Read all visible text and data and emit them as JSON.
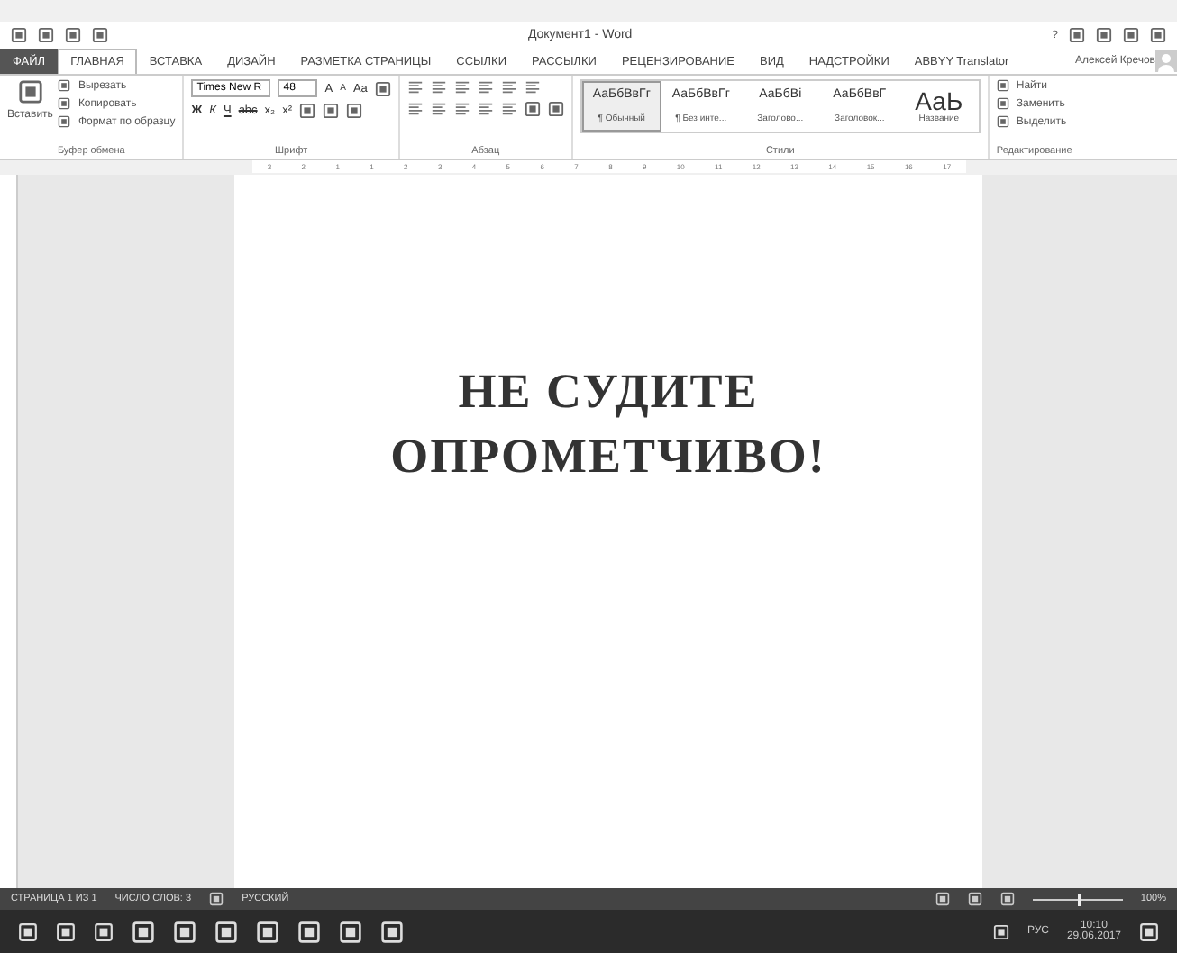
{
  "window": {
    "title": "Документ1 - Word",
    "help": "?",
    "user": "Алексей Кречов"
  },
  "tabs": [
    {
      "label": "ФАЙЛ",
      "kind": "file",
      "selected": false
    },
    {
      "label": "ГЛАВНАЯ",
      "kind": "tab",
      "selected": true
    },
    {
      "label": "ВСТАВКА",
      "kind": "tab",
      "selected": false
    },
    {
      "label": "ДИЗАЙН",
      "kind": "tab",
      "selected": false
    },
    {
      "label": "РАЗМЕТКА СТРАНИЦЫ",
      "kind": "tab",
      "selected": false
    },
    {
      "label": "ССЫЛКИ",
      "kind": "tab",
      "selected": false
    },
    {
      "label": "РАССЫЛКИ",
      "kind": "tab",
      "selected": false
    },
    {
      "label": "РЕЦЕНЗИРОВАНИЕ",
      "kind": "tab",
      "selected": false
    },
    {
      "label": "ВИД",
      "kind": "tab",
      "selected": false
    },
    {
      "label": "НАДСТРОЙКИ",
      "kind": "tab",
      "selected": false
    },
    {
      "label": "ABBYY Translator",
      "kind": "tab",
      "selected": false
    }
  ],
  "clipboard": {
    "paste": "Вставить",
    "items": [
      "Вырезать",
      "Копировать",
      "Формат по образцу"
    ],
    "label": "Буфер обмена"
  },
  "font": {
    "name": "Times New R",
    "size": "48",
    "grow": "A",
    "shrink": "A",
    "case": "Aa",
    "bold": "Ж",
    "italic": "К",
    "underline": "Ч",
    "strike": "abc",
    "sub": "x₂",
    "sup": "x²",
    "label": "Шрифт"
  },
  "paragraph": {
    "label": "Абзац"
  },
  "styles": {
    "label": "Стили",
    "items": [
      {
        "preview": "АаБбВвГг",
        "name": "¶ Обычный",
        "selected": true
      },
      {
        "preview": "АаБбВвГг",
        "name": "¶ Без инте...",
        "selected": false
      },
      {
        "preview": "АаБбВі",
        "name": "Заголово...",
        "selected": false
      },
      {
        "preview": "АаБбВвГ",
        "name": "Заголовок...",
        "selected": false
      },
      {
        "preview": "АаЬ",
        "name": "Название",
        "selected": false
      }
    ]
  },
  "editing": {
    "label": "Редактирование",
    "items": [
      "Найти",
      "Заменить",
      "Выделить"
    ]
  },
  "ruler": [
    "3",
    "2",
    "1",
    "1",
    "2",
    "3",
    "4",
    "5",
    "6",
    "7",
    "8",
    "9",
    "10",
    "11",
    "12",
    "13",
    "14",
    "15",
    "16",
    "17"
  ],
  "document": {
    "lines": [
      "НЕ СУДИТЕ",
      "ОПРОМЕТЧИВО!"
    ]
  },
  "status_bar": {
    "page": "СТРАНИЦА 1 ИЗ 1",
    "words": "ЧИСЛО СЛОВ: 3",
    "language": "РУССКИЙ",
    "zoom": "100%",
    "zoom_slider": {
      "level": 0.5
    }
  },
  "taskbar": {
    "lang": "РУС",
    "time": "10:10",
    "date": "29.06.2017"
  }
}
